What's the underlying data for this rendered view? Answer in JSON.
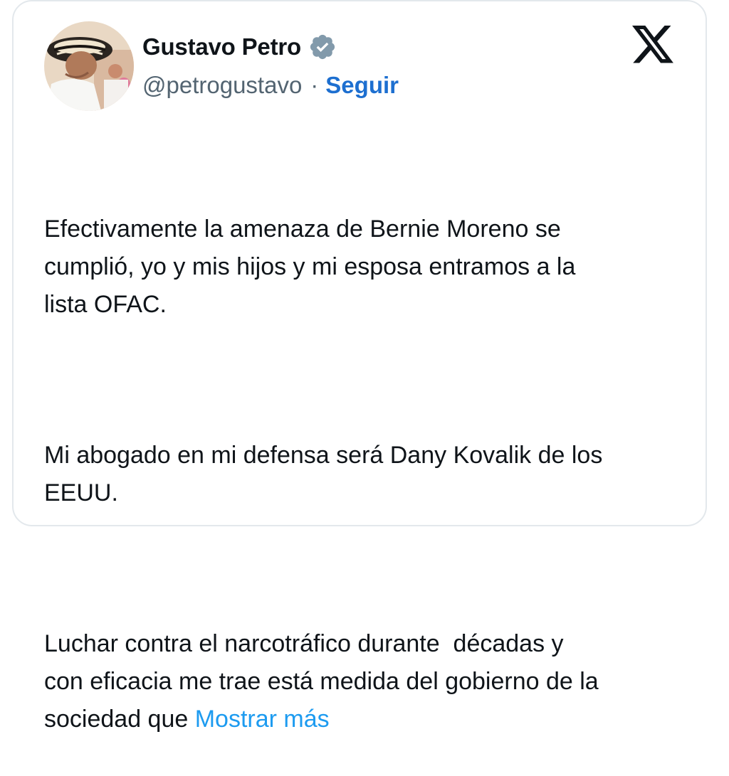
{
  "author": {
    "name": "Gustavo Petro",
    "handle": "@petrogustavo",
    "separator": "·",
    "follow_label": "Seguir",
    "verified_icon": "verified-badge-icon",
    "verified_color": "#829aab"
  },
  "brand": {
    "logo_icon": "x-logo-icon",
    "logo_color": "#0f1419"
  },
  "tweet": {
    "paragraphs": [
      "Efectivamente la amenaza de Bernie Moreno se\ncumplió, yo y mis hijos y mi esposa entramos a la\nlista OFAC.",
      "Mi abogado en mi defensa será Dany Kovalik de los\nEEUU.",
      "Luchar contra el narcotráfico durante  décadas y\ncon eficacia me trae está medida del gobierno de la\nsociedad que "
    ],
    "show_more_label": "Mostrar más"
  },
  "colors": {
    "text": "#0f1419",
    "secondary": "#536471",
    "link": "#1d9bf0",
    "follow": "#1d6fd0",
    "border": "#e3e8ec"
  }
}
